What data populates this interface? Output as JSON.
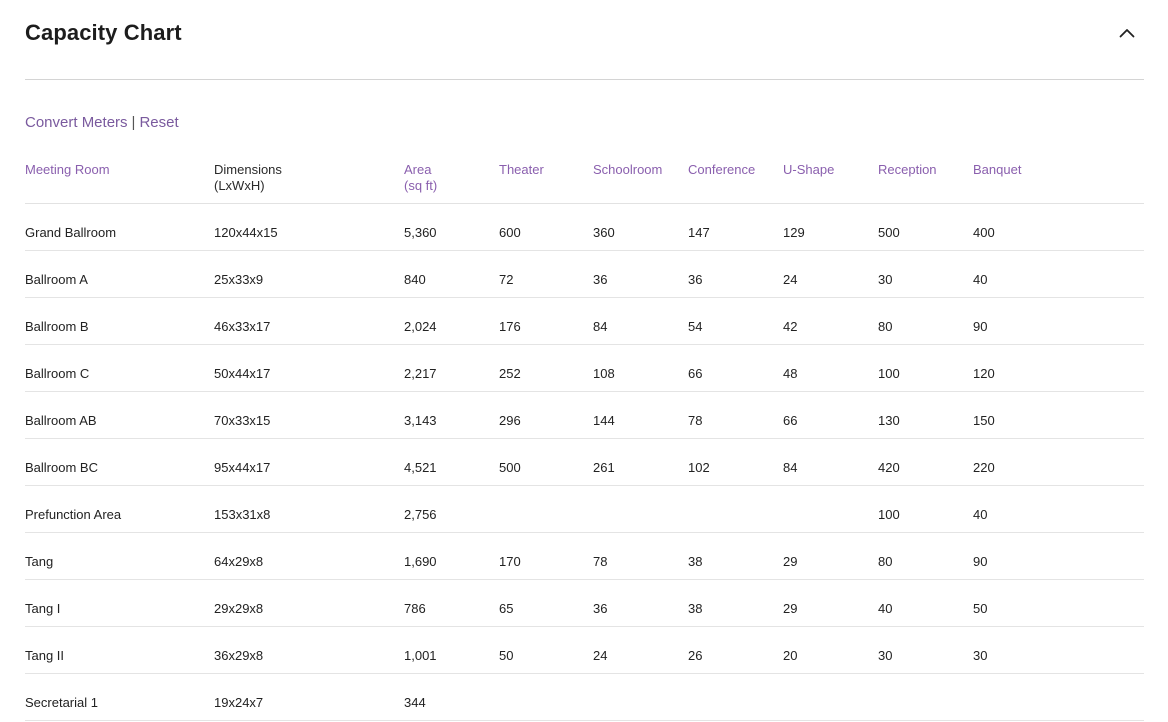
{
  "header": {
    "title": "Capacity Chart"
  },
  "actions": {
    "convert_label": "Convert Meters",
    "separator": "|",
    "reset_label": "Reset"
  },
  "table": {
    "columns": [
      {
        "line1": "Meeting Room",
        "line2": ""
      },
      {
        "line1": "Dimensions",
        "line2": "(LxWxH)"
      },
      {
        "line1": "Area",
        "line2": "(sq ft)"
      },
      {
        "line1": "Theater",
        "line2": ""
      },
      {
        "line1": "Schoolroom",
        "line2": ""
      },
      {
        "line1": "Conference",
        "line2": ""
      },
      {
        "line1": "U-Shape",
        "line2": ""
      },
      {
        "line1": "Reception",
        "line2": ""
      },
      {
        "line1": "Banquet",
        "line2": ""
      }
    ],
    "rows": [
      [
        "Grand Ballroom",
        "120x44x15",
        "5,360",
        "600",
        "360",
        "147",
        "129",
        "500",
        "400"
      ],
      [
        "Ballroom A",
        "25x33x9",
        "840",
        "72",
        "36",
        "36",
        "24",
        "30",
        "40"
      ],
      [
        "Ballroom B",
        "46x33x17",
        "2,024",
        "176",
        "84",
        "54",
        "42",
        "80",
        "90"
      ],
      [
        "Ballroom C",
        "50x44x17",
        "2,217",
        "252",
        "108",
        "66",
        "48",
        "100",
        "120"
      ],
      [
        "Ballroom AB",
        "70x33x15",
        "3,143",
        "296",
        "144",
        "78",
        "66",
        "130",
        "150"
      ],
      [
        "Ballroom BC",
        "95x44x17",
        "4,521",
        "500",
        "261",
        "102",
        "84",
        "420",
        "220"
      ],
      [
        "Prefunction Area",
        "153x31x8",
        "2,756",
        "",
        "",
        "",
        "",
        "100",
        "40"
      ],
      [
        "Tang",
        "64x29x8",
        "1,690",
        "170",
        "78",
        "38",
        "29",
        "80",
        "90"
      ],
      [
        "Tang I",
        "29x29x8",
        "786",
        "65",
        "36",
        "38",
        "29",
        "40",
        "50"
      ],
      [
        "Tang II",
        "36x29x8",
        "1,001",
        "50",
        "24",
        "26",
        "20",
        "30",
        "30"
      ],
      [
        "Secretarial 1",
        "19x24x7",
        "344",
        "",
        "",
        "",
        "",
        "",
        ""
      ]
    ]
  },
  "colors": {
    "accent": "#8a5fae",
    "link": "#7a5a9e",
    "text": "#222222",
    "divider": "#e4e4e4"
  }
}
